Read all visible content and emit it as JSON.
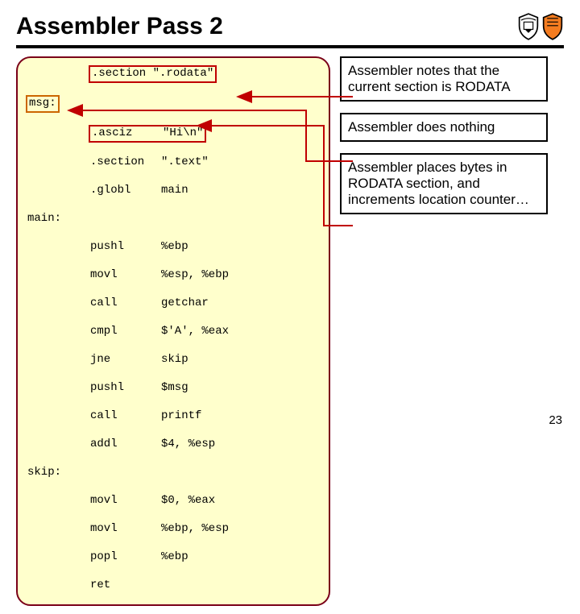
{
  "title": "Assembler Pass 2",
  "code": {
    "line_section_rodata": ".section \".rodata\"",
    "label_msg": "msg:",
    "asciz_mn": ".asciz",
    "asciz_op": "\"Hi\\n\"",
    "section_text_mn": ".section",
    "section_text_op": "\".text\"",
    "globl_mn": ".globl",
    "globl_op": "main",
    "label_main": "main:",
    "pushl1_mn": "pushl",
    "pushl1_op": "%ebp",
    "movl1_mn": "movl",
    "movl1_op": "%esp, %ebp",
    "call1_mn": "call",
    "call1_op": "getchar",
    "cmpl_mn": "cmpl",
    "cmpl_op": "$'A', %eax",
    "jne_mn": "jne",
    "jne_op": "skip",
    "pushl2_mn": "pushl",
    "pushl2_op": "$msg",
    "call2_mn": "call",
    "call2_op": "printf",
    "addl_mn": "addl",
    "addl_op": "$4, %esp",
    "label_skip": "skip:",
    "movl2_mn": "movl",
    "movl2_op": "$0, %eax",
    "movl3_mn": "movl",
    "movl3_op": "%ebp, %esp",
    "popl_mn": "popl",
    "popl_op": "%ebp",
    "ret_mn": "ret"
  },
  "notes": {
    "n1": "Assembler notes that the current section is RODATA",
    "n2": "Assembler does nothing",
    "n3": "Assembler places bytes in RODATA section, and increments location counter…"
  },
  "pagenum": "23"
}
